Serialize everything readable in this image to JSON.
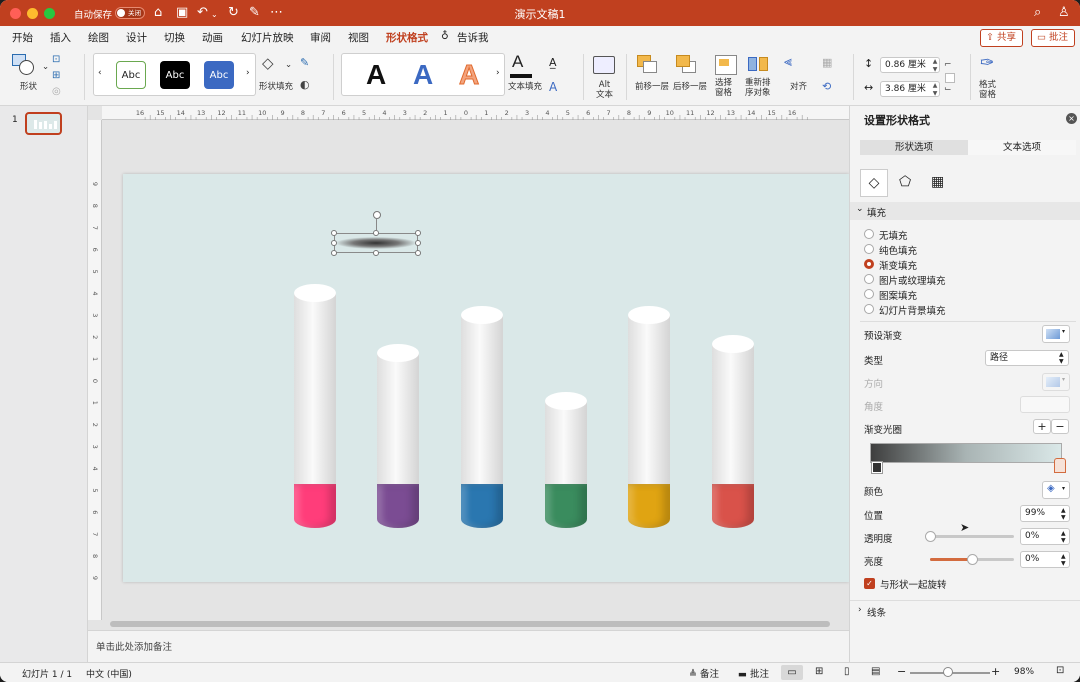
{
  "window": {
    "title": "演示文稿1",
    "autosave_label": "自动保存",
    "autosave_state": "关闭"
  },
  "tabs": [
    "开始",
    "插入",
    "绘图",
    "设计",
    "切换",
    "动画",
    "幻灯片放映",
    "审阅",
    "视图",
    "形状格式"
  ],
  "tell_me": "告诉我",
  "share_label": "共享",
  "comments_label": "批注",
  "ribbon": {
    "shape_label": "形状",
    "style_abc": [
      "Abc",
      "Abc",
      "Abc"
    ],
    "shape_fill_label": "形状填充",
    "wordart_letter": "A",
    "text_fill_label": "文本填充",
    "alt_text_label": "Alt\n文本",
    "bring_forward_label": "前移一层",
    "send_backward_label": "后移一层",
    "selection_pane_label": "选择\n窗格",
    "reorder_label": "重新排\n序对象",
    "align_label": "对齐",
    "height_value": "0.86 厘米",
    "width_value": "3.86 厘米",
    "format_pane_label": "格式\n窗格"
  },
  "slide_number": "1",
  "ruler_top": [
    "16",
    "15",
    "14",
    "13",
    "12",
    "11",
    "10",
    "9",
    "8",
    "7",
    "6",
    "5",
    "4",
    "3",
    "2",
    "1",
    "0",
    "1",
    "2",
    "3",
    "4",
    "5",
    "6",
    "7",
    "8",
    "9",
    "10",
    "11",
    "12",
    "13",
    "14",
    "15",
    "16"
  ],
  "ruler_left": [
    "9",
    "8",
    "7",
    "6",
    "5",
    "4",
    "3",
    "2",
    "1",
    "0",
    "1",
    "2",
    "3",
    "4",
    "5",
    "6",
    "7",
    "8",
    "9"
  ],
  "cylinders": {
    "heights": [
      0.87,
      0.65,
      0.79,
      0.47,
      0.79,
      0.68
    ],
    "colors": [
      "#ff3d7a",
      "#7b4c93",
      "#2a77b0",
      "#3a8c5e",
      "#e0a412",
      "#d9524a"
    ]
  },
  "notes_placeholder": "单击此处添加备注",
  "status": {
    "slide_counter": "幻灯片 1 / 1",
    "language": "中文 (中国)",
    "notes_btn": "备注",
    "comments_btn": "批注",
    "zoom": "98%"
  },
  "format_pane": {
    "title": "设置形状格式",
    "tab_shape": "形状选项",
    "tab_text": "文本选项",
    "fill_header": "填充",
    "fill_options": [
      "无填充",
      "纯色填充",
      "渐变填充",
      "图片或纹理填充",
      "图案填充",
      "幻灯片背景填充"
    ],
    "selected_fill": 2,
    "preset_gradient_label": "预设渐变",
    "type_label": "类型",
    "type_value": "路径",
    "direction_label": "方向",
    "angle_label": "角度",
    "gradient_stops_label": "渐变光圈",
    "color_label": "颜色",
    "position_label": "位置",
    "position_value": "99%",
    "transparency_label": "透明度",
    "transparency_value": "0%",
    "transparency_level": 0,
    "brightness_label": "亮度",
    "brightness_value": "0%",
    "brightness_level": 0.5,
    "rotate_with_shape_label": "与形状一起旋转",
    "line_header": "线条"
  },
  "accent_color": "#c0401f"
}
